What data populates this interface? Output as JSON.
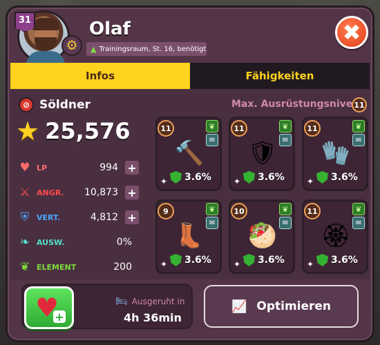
{
  "header": {
    "level": "31",
    "name": "Olaf",
    "requirement": "Trainingsraum, St. 16, benötigt",
    "close_icon": "✖"
  },
  "tabs": [
    {
      "label": "Infos",
      "active": true
    },
    {
      "label": "Fähigkeiten",
      "active": false
    }
  ],
  "hero": {
    "class_name": "Söldner",
    "power": "25,576"
  },
  "stats": [
    {
      "icon": "heart-icon",
      "glyph": "♥",
      "color": "#ff6b6b",
      "label": "LP",
      "value": "994",
      "plus": true
    },
    {
      "icon": "sword-icon",
      "glyph": "⚔",
      "color": "#ff4a4a",
      "label": "ANGR.",
      "value": "10,873",
      "plus": true
    },
    {
      "icon": "shield-icon",
      "glyph": "⛨",
      "color": "#4aa6ff",
      "label": "VERT.",
      "value": "4,812",
      "plus": true
    },
    {
      "icon": "wing-icon",
      "glyph": "❧",
      "color": "#53e0c9",
      "label": "AUSW.",
      "value": "0%",
      "plus": false
    },
    {
      "icon": "leaf-icon",
      "glyph": "❦",
      "color": "#7cdc3a",
      "label": "ELEMENT",
      "value": "200",
      "plus": false
    }
  ],
  "equipment": {
    "title": "Max. Ausrüstungsniveau",
    "max_level": "11",
    "slots": [
      {
        "level": "11",
        "item": "hammer",
        "glyph": "🔨",
        "bonus": "3.6%"
      },
      {
        "level": "11",
        "item": "armor",
        "glyph": "🛡",
        "bonus": "3.6%"
      },
      {
        "level": "11",
        "item": "bracers",
        "glyph": "🧤",
        "bonus": "3.6%"
      },
      {
        "level": "9",
        "item": "boots",
        "glyph": "👢",
        "bonus": "3.6%"
      },
      {
        "level": "10",
        "item": "food",
        "glyph": "🥙",
        "bonus": "3.6%"
      },
      {
        "level": "11",
        "item": "amulet",
        "glyph": "🏵",
        "bonus": "3.6%"
      }
    ]
  },
  "rest": {
    "label": "Ausgeruht in",
    "time": "4h 36min"
  },
  "optimize_label": "Optimieren"
}
